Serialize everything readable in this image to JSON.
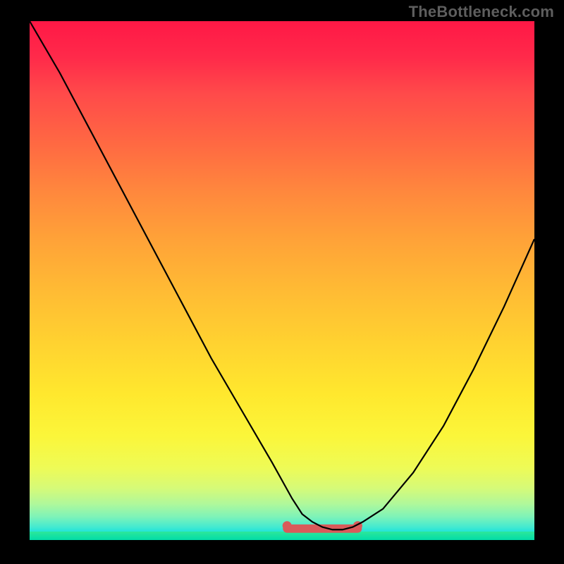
{
  "watermark": "TheBottleneck.com",
  "chart_data": {
    "type": "line",
    "title": "",
    "xlabel": "",
    "ylabel": "",
    "xlim": [
      0,
      100
    ],
    "ylim": [
      0,
      100
    ],
    "grid": false,
    "series": [
      {
        "name": "bottleneck-curve",
        "x": [
          0,
          6,
          12,
          18,
          24,
          30,
          36,
          42,
          48,
          52,
          54,
          56,
          58,
          60,
          62,
          64,
          66,
          70,
          76,
          82,
          88,
          94,
          100
        ],
        "values": [
          100,
          90,
          79,
          68,
          57,
          46,
          35,
          25,
          15,
          8,
          5,
          3.5,
          2.5,
          2,
          2,
          2.5,
          3.5,
          6,
          13,
          22,
          33,
          45,
          58
        ]
      }
    ],
    "valley_band": {
      "x_start": 51,
      "x_end": 65,
      "y": 2.2,
      "thickness_pct": 1.6
    },
    "colors": {
      "curve": "#000000",
      "valley_marker": "#d95a5a",
      "gradient_top": "#ff1846",
      "gradient_mid": "#ffd230",
      "gradient_bottom": "#00d8ea",
      "green_band": "#2de89a",
      "frame": "#000000"
    }
  }
}
